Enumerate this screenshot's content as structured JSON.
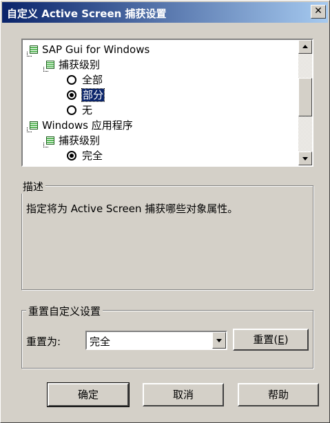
{
  "window": {
    "title": "自定义 Active Screen 捕获设置",
    "close_glyph": "✕"
  },
  "tree": {
    "nodes": [
      {
        "kind": "folder",
        "label": "SAP Gui for Windows"
      },
      {
        "kind": "folder",
        "label": "捕获级别"
      },
      {
        "kind": "radio",
        "label": "全部",
        "checked": false
      },
      {
        "kind": "radio",
        "label": "部分",
        "checked": true,
        "selected": true
      },
      {
        "kind": "radio",
        "label": "无",
        "checked": false
      },
      {
        "kind": "folder",
        "label": "Windows 应用程序"
      },
      {
        "kind": "folder",
        "label": "捕获级别"
      },
      {
        "kind": "radio",
        "label": "完全",
        "checked": true
      }
    ]
  },
  "description": {
    "label": "描述",
    "text": "指定将为 Active Screen 捕获哪些对象属性。"
  },
  "reset": {
    "label": "重置自定义设置",
    "reset_to_label": "重置为:",
    "combo_value": "完全",
    "reset_button": "重置",
    "reset_button_key": "E"
  },
  "buttons": {
    "ok": "确定",
    "cancel": "取消",
    "help": "帮助"
  },
  "icons": [
    "tree-folder-icon",
    "radio-icon",
    "scroll-up-icon",
    "scroll-down-icon",
    "dropdown-icon",
    "close-icon"
  ]
}
